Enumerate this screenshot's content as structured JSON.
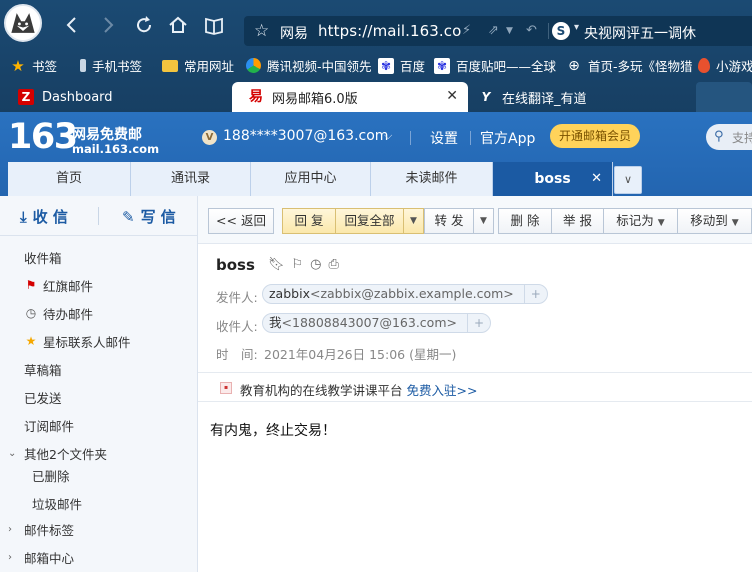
{
  "browser": {
    "site_label": "网易",
    "url": "https://mail.163.co",
    "news_text": "央视网评五一调休",
    "bookmarks": [
      {
        "label": "书签",
        "icon": "star-icon"
      },
      {
        "label": "手机书签",
        "icon": "phone-icon"
      },
      {
        "label": "常用网址",
        "icon": "folder-icon"
      },
      {
        "label": "腾讯视频-中国领先",
        "icon": "tencent-video-icon"
      },
      {
        "label": "百度",
        "icon": "baidu-paw-icon"
      },
      {
        "label": "百度贴吧——全球",
        "icon": "baidu-paw-icon"
      },
      {
        "label": "首页-多玩《怪物猎",
        "icon": "globe-icon"
      },
      {
        "label": "小游戏",
        "icon": "balloon-icon"
      }
    ],
    "tabs": [
      {
        "label": "Dashboard",
        "icon": "zabbix-z-icon"
      },
      {
        "label": "网易邮箱6.0版",
        "icon": "netease-icon"
      },
      {
        "label": "在线翻译_有道",
        "icon": "youdao-icon"
      }
    ]
  },
  "mail_header": {
    "logo_number": "163",
    "logo_title": "网易免费邮",
    "logo_domain": "mail.163.com",
    "user_badge": "V",
    "account": "188****3007@163.com",
    "settings": "设置",
    "app": "官方App",
    "vip": "开通邮箱会员",
    "search_placeholder": "支持"
  },
  "mail_tabs": [
    "首页",
    "通讯录",
    "应用中心",
    "未读邮件",
    "boss"
  ],
  "sidebar": {
    "receive": "收 信",
    "write": "写 信",
    "folders": [
      {
        "label": "收件箱",
        "icon": ""
      },
      {
        "label": "红旗邮件",
        "icon": "red-flag-icon"
      },
      {
        "label": "待办邮件",
        "icon": "clock-icon"
      },
      {
        "label": "星标联系人邮件",
        "icon": "star-icon"
      },
      {
        "label": "草稿箱",
        "icon": ""
      },
      {
        "label": "已发送",
        "icon": ""
      },
      {
        "label": "订阅邮件",
        "icon": ""
      },
      {
        "label": "其他2个文件夹",
        "icon": "caret-down-icon"
      },
      {
        "label": "已删除",
        "icon": ""
      },
      {
        "label": "垃圾邮件",
        "icon": ""
      },
      {
        "label": "邮件标签",
        "icon": "caret-right-icon"
      },
      {
        "label": "邮箱中心",
        "icon": "caret-right-icon"
      }
    ]
  },
  "toolbar": {
    "back": "<< 返回",
    "reply": "回 复",
    "reply_all": "回复全部",
    "forward": "转 发",
    "delete": "删 除",
    "report": "举 报",
    "mark_as": "标记为",
    "move_to": "移动到"
  },
  "message": {
    "subject": "boss",
    "from_label": "发件人:",
    "from_name": "zabbix",
    "from_email": "<zabbix@zabbix.example.com>",
    "to_label": "收件人:",
    "to_name": "我",
    "to_email": "<18808843007@163.com>",
    "time_label": "时　间:",
    "time_value": "2021年04月26日 15:06 (星期一)",
    "ad_text": "教育机构的在线教学讲课平台 ",
    "ad_link": "免费入驻>>",
    "body": "有内鬼，终止交易！"
  }
}
